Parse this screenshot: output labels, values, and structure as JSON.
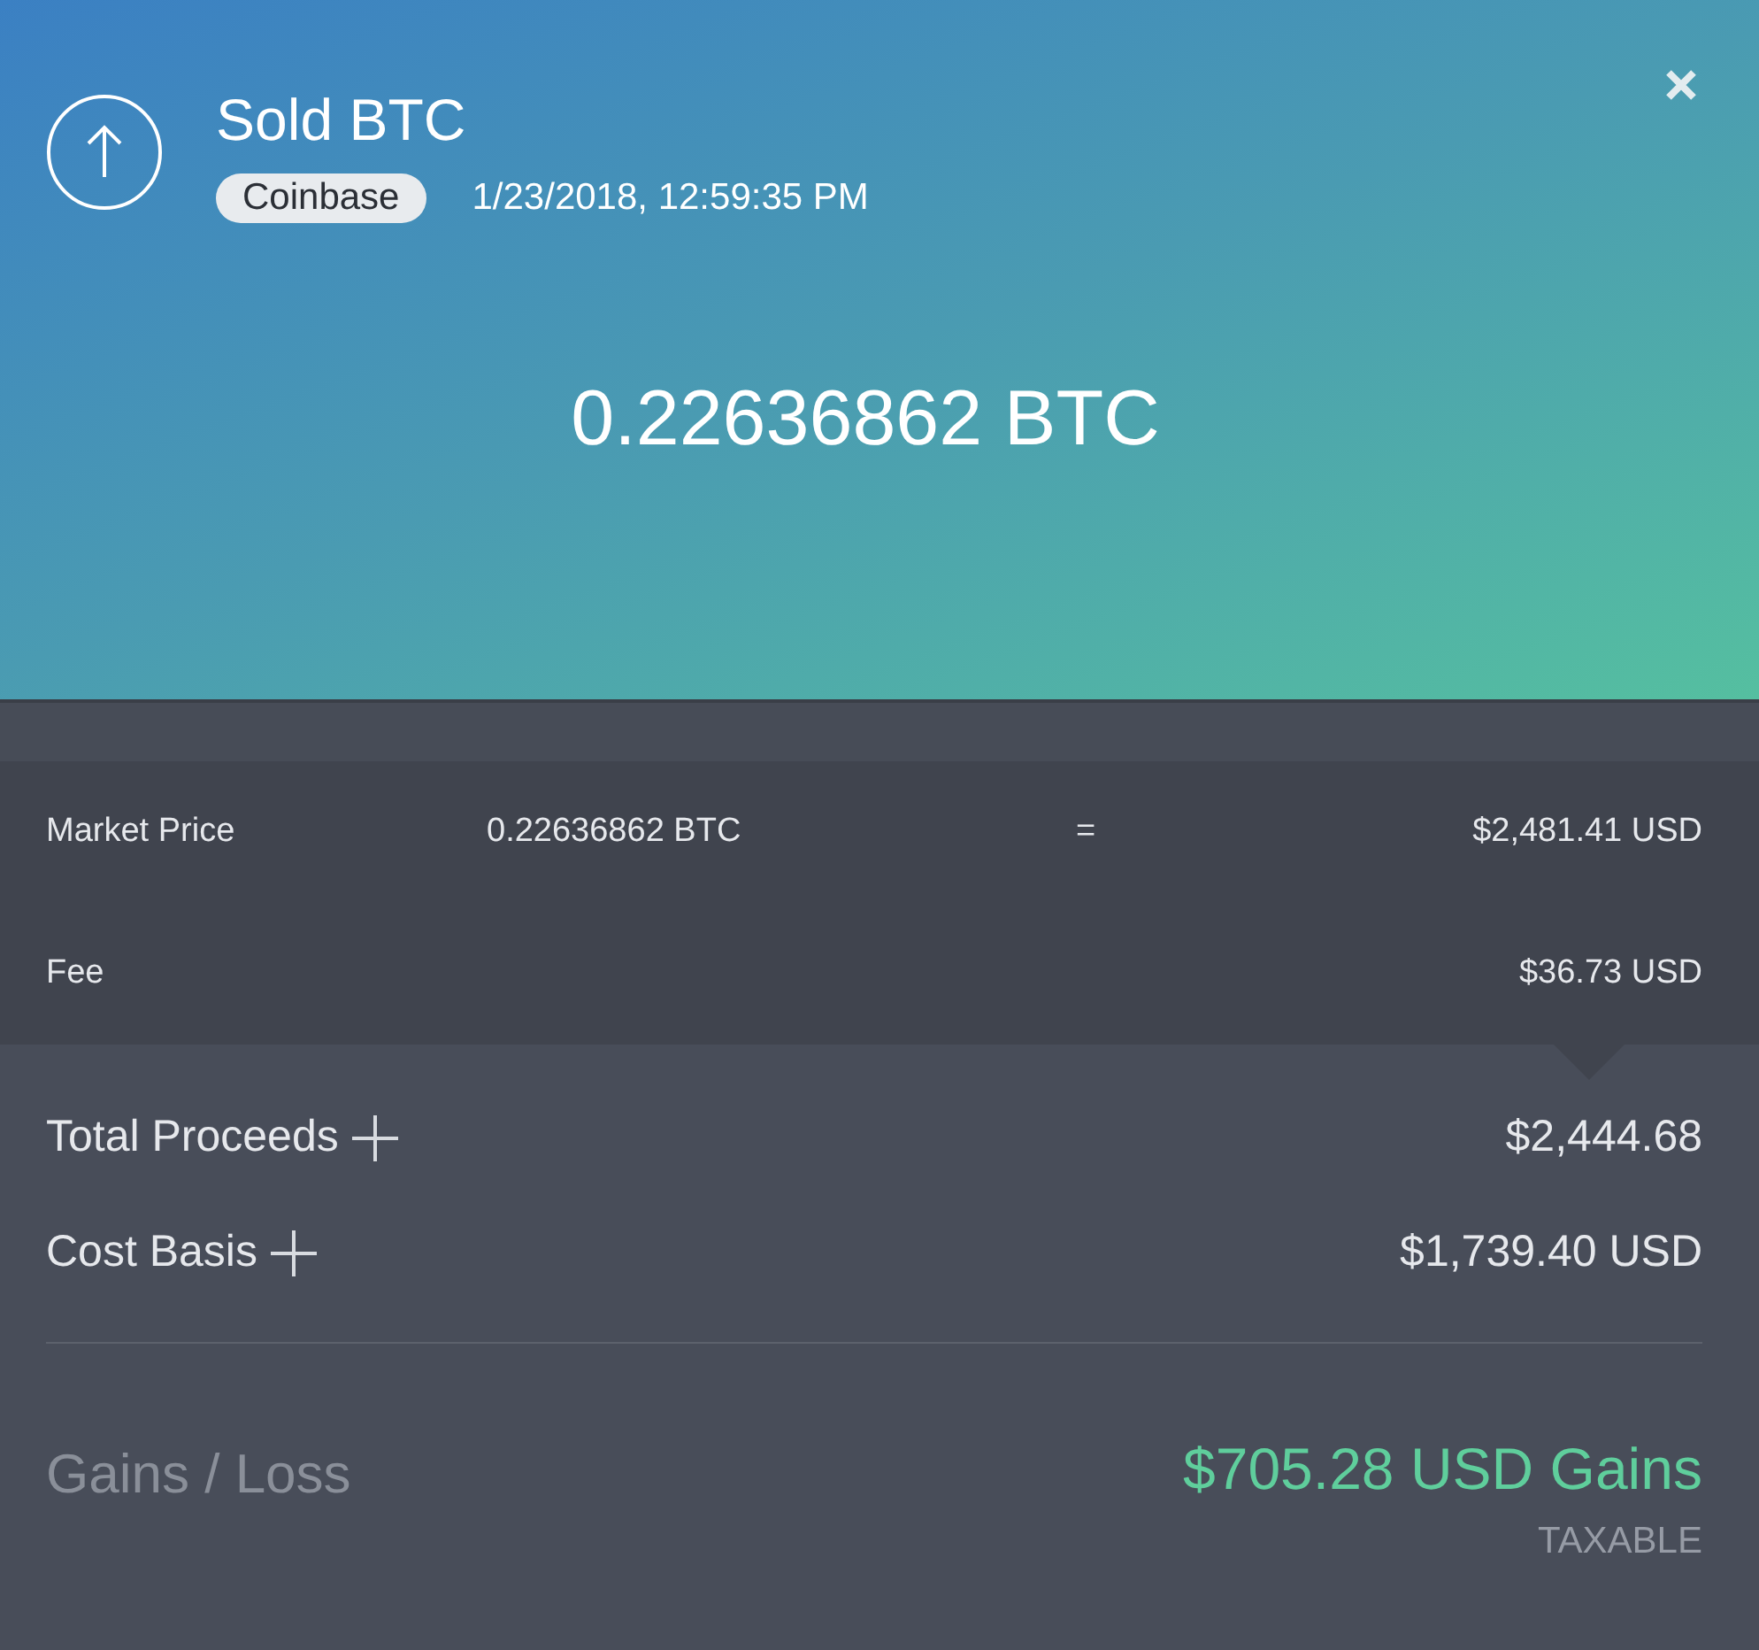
{
  "header": {
    "title": "Sold BTC",
    "exchange": "Coinbase",
    "timestamp": "1/23/2018, 12:59:35 PM",
    "amount": "0.22636862 BTC"
  },
  "details": [
    {
      "kind": "price",
      "label": "Market Price",
      "quantity": "0.22636862 BTC",
      "operator": "=",
      "value": "$2,481.41 USD"
    },
    {
      "kind": "plain",
      "label": "Fee",
      "value": "$36.73 USD"
    }
  ],
  "summary": [
    {
      "label": "Total Proceeds",
      "value": "$2,444.68"
    },
    {
      "label": "Cost Basis",
      "value": "$1,739.40 USD"
    }
  ],
  "result": {
    "label": "Gains / Loss",
    "value": "$705.28 USD Gains",
    "color": "#5fce9c",
    "tag": "TAXABLE"
  }
}
